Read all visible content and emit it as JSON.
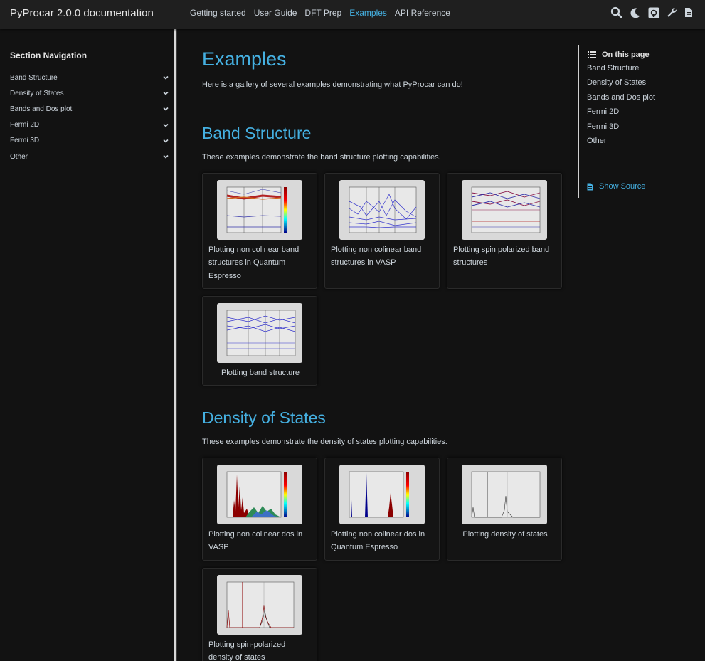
{
  "header": {
    "brand": "PyProcar 2.0.0 documentation",
    "nav": [
      {
        "label": "Getting started"
      },
      {
        "label": "User Guide"
      },
      {
        "label": "DFT Prep"
      },
      {
        "label": "Examples"
      },
      {
        "label": "API Reference"
      }
    ],
    "active_nav": "Examples",
    "icons": [
      "search-icon",
      "moon-icon",
      "github-icon",
      "wrench-icon",
      "file-icon"
    ]
  },
  "sidebar": {
    "title": "Section Navigation",
    "items": [
      {
        "label": "Band Structure"
      },
      {
        "label": "Density of States"
      },
      {
        "label": "Bands and Dos plot"
      },
      {
        "label": "Fermi 2D"
      },
      {
        "label": "Fermi 3D"
      },
      {
        "label": "Other"
      }
    ]
  },
  "main": {
    "title": "Examples",
    "intro": "Here is a gallery of several examples demonstrating what PyProcar can do!",
    "sections": [
      {
        "heading": "Band Structure",
        "description": "These examples demonstrate the band structure plotting capabilities.",
        "cards": [
          {
            "caption": "Plotting non colinear band structures in Quantum Espresso"
          },
          {
            "caption": "Plotting non colinear band structures in VASP"
          },
          {
            "caption": "Plotting spin polarized band structures"
          },
          {
            "caption": "Plotting band structure"
          }
        ]
      },
      {
        "heading": "Density of States",
        "description": "These examples demonstrate the density of states plotting capabilities.",
        "cards": [
          {
            "caption": "Plotting non colinear dos in VASP"
          },
          {
            "caption": "Plotting non colinear dos in Quantum Espresso"
          },
          {
            "caption": "Plotting density of states"
          },
          {
            "caption": "Plotting spin-polarized density of states"
          }
        ]
      }
    ]
  },
  "toc": {
    "title": "On this page",
    "items": [
      {
        "label": "Band Structure"
      },
      {
        "label": "Density of States"
      },
      {
        "label": "Bands and Dos plot"
      },
      {
        "label": "Fermi 2D"
      },
      {
        "label": "Fermi 3D"
      },
      {
        "label": "Other"
      }
    ],
    "show_source": "Show Source"
  },
  "colors": {
    "background": "#121212",
    "header": "#1f1f1f",
    "accent": "#45b0e1",
    "text": "#ced6dd"
  }
}
